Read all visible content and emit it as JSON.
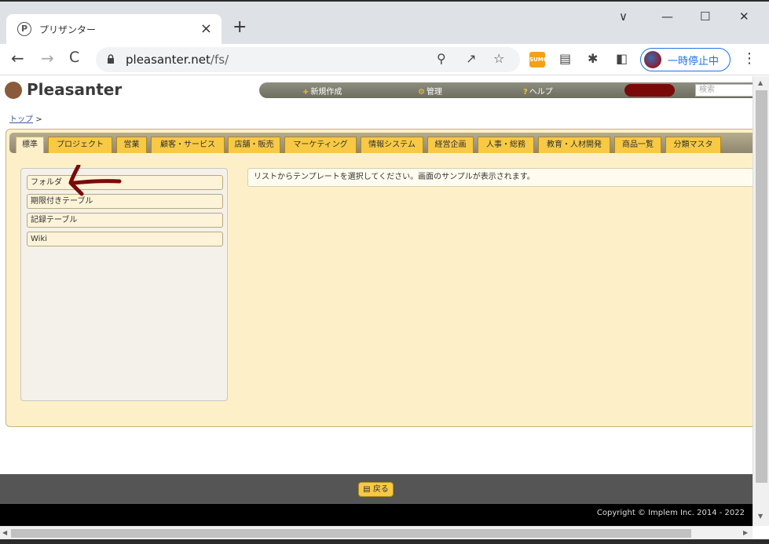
{
  "browser": {
    "tab_title": "プリザンター",
    "favicon_letter": "P",
    "new_tab_symbol": "+",
    "tab_close_symbol": "×",
    "url_host": "pleasanter.net",
    "url_path": "/fs/",
    "profile_label": "一時停止中",
    "window_controls": {
      "dropdown": "∨",
      "minimize": "—",
      "maximize": "☐",
      "close": "✕"
    },
    "nav": {
      "back": "←",
      "forward": "→",
      "reload": "C"
    }
  },
  "app": {
    "logo_text": "Pleasanter",
    "menu": {
      "new_label": "新規作成",
      "new_icon": "+",
      "admin_label": "管理",
      "admin_icon": "⚙",
      "help_label": "ヘルプ",
      "help_icon": "?",
      "search_placeholder": "検索"
    },
    "breadcrumb": {
      "top_link": "トップ",
      "separator": ">"
    },
    "category_tabs": [
      "標準",
      "プロジェクト",
      "営業",
      "顧客・サービス",
      "店舗・販売",
      "マーケティング",
      "情報システム",
      "経営企画",
      "人事・総務",
      "教育・人材開発",
      "商品一覧",
      "分類マスタ"
    ],
    "template_items": [
      "フォルダ",
      "期限付きテーブル",
      "記録テーブル",
      "Wiki"
    ],
    "message": "リストからテンプレートを選択してください。画面のサンプルが表示されます。",
    "back_button": "戻る",
    "copyright": "Copyright © Implem Inc. 2014 - 2022"
  },
  "colors": {
    "tab_yellow": "#f7c945",
    "panel_bg": "#fdf0c8",
    "annotation_arrow": "#7a0a0a",
    "profile_blue": "#1a73e8"
  }
}
